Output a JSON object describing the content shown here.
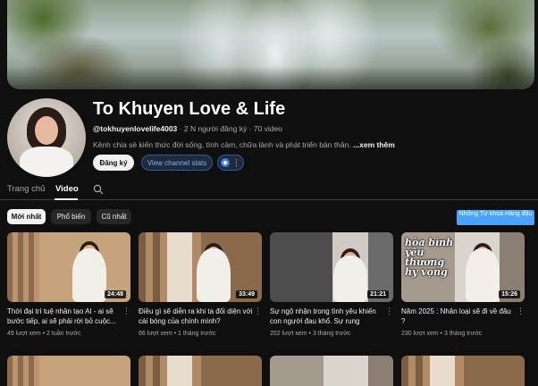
{
  "channel": {
    "name": "To Khuyen Love & Life",
    "handle": "@tokhuyenlovelife4003",
    "subscribers": "2 N người đăng ký",
    "video_count": "70 video",
    "description": "Kênh chia sẻ kiến thức đời sống, tình cảm, chữa lành và phát triển bản thân.",
    "more_label": "...xem thêm"
  },
  "actions": {
    "subscribe_label": "Đăng ký",
    "stats_label": "View channel stats"
  },
  "tabs": [
    {
      "label": "Trang chủ"
    },
    {
      "label": "Video"
    }
  ],
  "filters": [
    {
      "label": "Mới nhất"
    },
    {
      "label": "Phổ biến"
    },
    {
      "label": "Cũ nhất"
    }
  ],
  "keyword_button": "Những Từ khoá Hàng đầu",
  "videos": [
    {
      "title": "Thời đại trí tuệ nhân tạo AI - ai sẽ bước tiếp, ai sẽ phải rời bỏ cuộc...",
      "duration": "24:48",
      "views": "49 lượt xem",
      "age": "2 tuần trước"
    },
    {
      "title": "Điều gì sẽ diễn ra khi ta đối diện với cái bóng của chính mình?",
      "duration": "33:49",
      "views": "66 lượt xem",
      "age": "1 tháng trước"
    },
    {
      "title": "Sự ngộ nhận trong tình yêu khiến con người đau khổ. Sự rung động,...",
      "duration": "21:21",
      "views": "202 lượt xem",
      "age": "3 tháng trước"
    },
    {
      "title": "Năm 2025 : Nhân loại sẽ đi về đâu ?",
      "duration": "15:26",
      "views": "230 lượt xem",
      "age": "3 tháng trước",
      "thumb_text": "hòa bình yêu thương hy vọng"
    }
  ]
}
